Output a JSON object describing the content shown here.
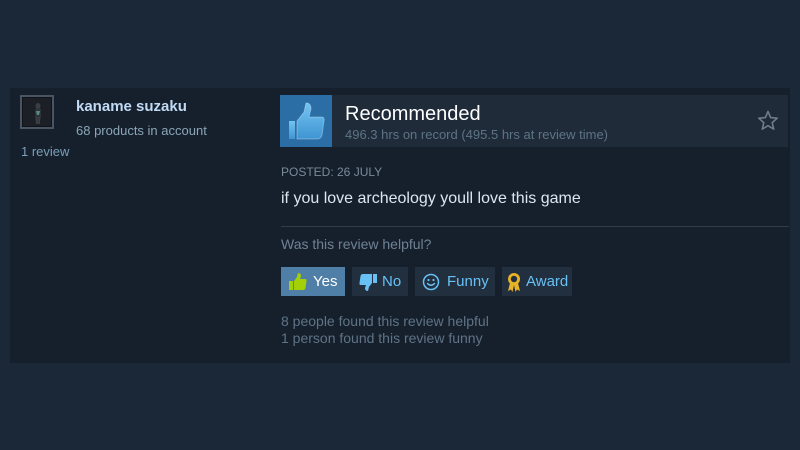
{
  "reviewer": {
    "name": "kaname suzaku",
    "products": "68 products in account",
    "review_count": "1 review"
  },
  "recommendation": {
    "title": "Recommended",
    "hours": "496.3 hrs on record (495.5 hrs at review time)",
    "icon": "thumbs-up-icon"
  },
  "review": {
    "posted": "POSTED: 26 JULY",
    "text": "if you love archeology youll love this game"
  },
  "helpful": {
    "question": "Was this review helpful?",
    "buttons": {
      "yes": "Yes",
      "no": "No",
      "funny": "Funny",
      "award": "Award"
    },
    "stats": {
      "helpful": "8 people found this review helpful",
      "funny": "1 person found this review funny"
    }
  },
  "colors": {
    "page_background": "#1b2838",
    "card_background": "#16202d",
    "accent_blue": "#67c1f5",
    "thumb_box": "#2b6ea6",
    "active_button": "#4f7ea6"
  }
}
